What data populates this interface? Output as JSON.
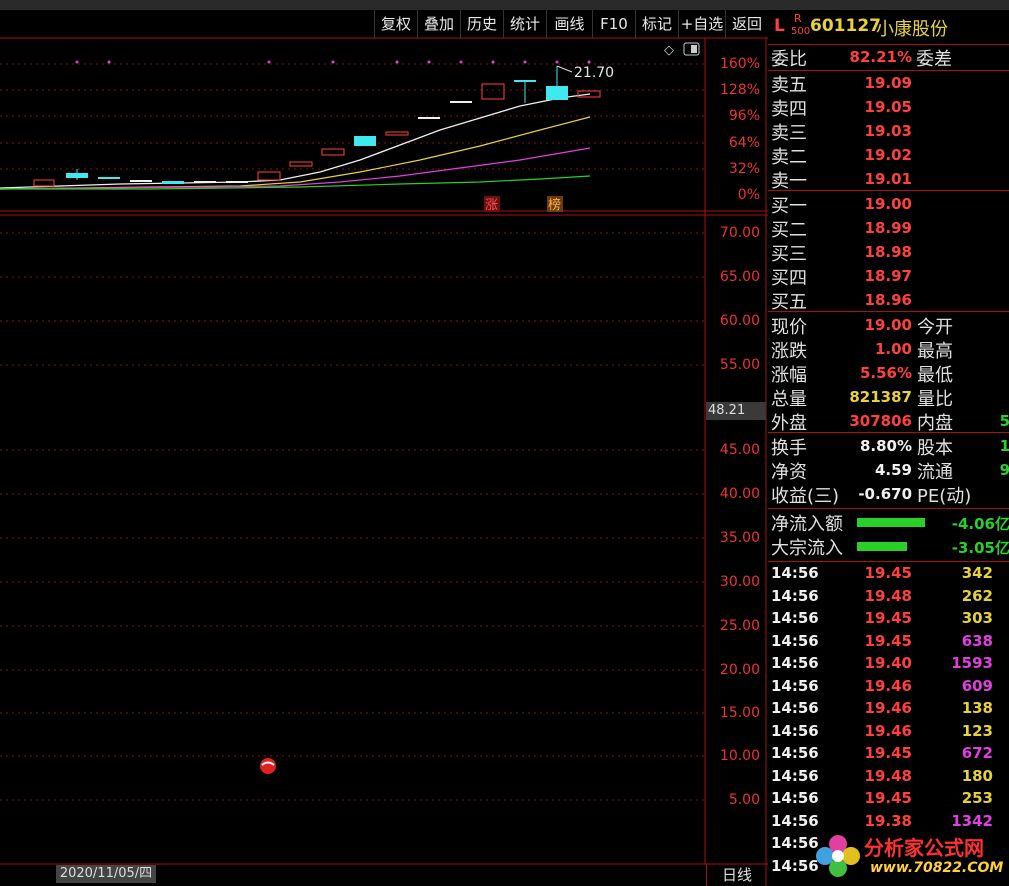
{
  "toolbar": {
    "buttons": [
      "复权",
      "叠加",
      "历史",
      "统计",
      "画线",
      "F10",
      "标记",
      "+自选",
      "返回"
    ]
  },
  "stock": {
    "flag_l": "L",
    "flag_r": "R",
    "flag_sub": "500",
    "code": "601127",
    "name": "小康股份"
  },
  "chart_tags": {
    "zhang": "涨",
    "bang": "榜",
    "peak_price": "21.70",
    "cursor_value": "48.21",
    "date": "2020/11/05/四",
    "period": "日线"
  },
  "pct_ticks": [
    "160%",
    "128%",
    "96%",
    "64%",
    "32%",
    "0%"
  ],
  "price_ticks": [
    "70.00",
    "65.00",
    "60.00",
    "55.00",
    "45.00",
    "40.00",
    "35.00",
    "30.00",
    "25.00",
    "20.00",
    "15.00",
    "10.00",
    "5.00"
  ],
  "quote": {
    "weibi_label": "委比",
    "weibi_value": "82.21%",
    "weicha_label": "委差",
    "sells": [
      {
        "label": "卖五",
        "price": "19.09"
      },
      {
        "label": "卖四",
        "price": "19.05"
      },
      {
        "label": "卖三",
        "price": "19.03"
      },
      {
        "label": "卖二",
        "price": "19.02"
      },
      {
        "label": "卖一",
        "price": "19.01"
      }
    ],
    "buys": [
      {
        "label": "买一",
        "price": "19.00"
      },
      {
        "label": "买二",
        "price": "18.99"
      },
      {
        "label": "买三",
        "price": "18.98"
      },
      {
        "label": "买四",
        "price": "18.97"
      },
      {
        "label": "买五",
        "price": "18.96"
      }
    ],
    "stats": [
      {
        "label": "现价",
        "value": "19.00",
        "label2": "今开",
        "value2": ""
      },
      {
        "label": "涨跌",
        "value": "1.00",
        "label2": "最高",
        "value2": ""
      },
      {
        "label": "涨幅",
        "value": "5.56%",
        "label2": "最低",
        "value2": ""
      },
      {
        "label": "总量",
        "value": "821387",
        "label2": "量比",
        "value2": ""
      },
      {
        "label": "外盘",
        "value": "307806",
        "label2": "内盘",
        "value2": "5"
      }
    ],
    "stats2": [
      {
        "label": "换手",
        "value": "8.80%",
        "label2": "股本",
        "value2": "1"
      },
      {
        "label": "净资",
        "value": "4.59",
        "label2": "流通",
        "value2": "9"
      },
      {
        "label": "收益(三)",
        "value": "-0.670",
        "label2": "PE(动)",
        "value2": ""
      }
    ],
    "flows": [
      {
        "label": "净流入额",
        "value": "-4.06亿"
      },
      {
        "label": "大宗流入",
        "value": "-3.05亿"
      }
    ]
  },
  "ticks": [
    {
      "time": "14:56",
      "price": "19.45",
      "vol": "342"
    },
    {
      "time": "14:56",
      "price": "19.48",
      "vol": "262"
    },
    {
      "time": "14:56",
      "price": "19.45",
      "vol": "303"
    },
    {
      "time": "14:56",
      "price": "19.45",
      "vol": "638"
    },
    {
      "time": "14:56",
      "price": "19.40",
      "vol": "1593"
    },
    {
      "time": "14:56",
      "price": "19.46",
      "vol": "609"
    },
    {
      "time": "14:56",
      "price": "19.46",
      "vol": "138"
    },
    {
      "time": "14:56",
      "price": "19.46",
      "vol": "123"
    },
    {
      "time": "14:56",
      "price": "19.45",
      "vol": "672"
    },
    {
      "time": "14:56",
      "price": "19.48",
      "vol": "180"
    },
    {
      "time": "14:56",
      "price": "19.45",
      "vol": "253"
    },
    {
      "time": "14:56",
      "price": "19.38",
      "vol": "1342"
    },
    {
      "time": "14:56",
      "price": "",
      "vol": ""
    },
    {
      "time": "14:56",
      "price": "",
      "vol": ""
    }
  ],
  "watermark": {
    "text": "分析家公式网",
    "url": "www.70822.COM"
  },
  "colors": {
    "grid": "#aa1010",
    "up": "#ff4040",
    "down": "#40e8f0",
    "yellow": "#e8d23a",
    "magenta": "#e040e0"
  }
}
